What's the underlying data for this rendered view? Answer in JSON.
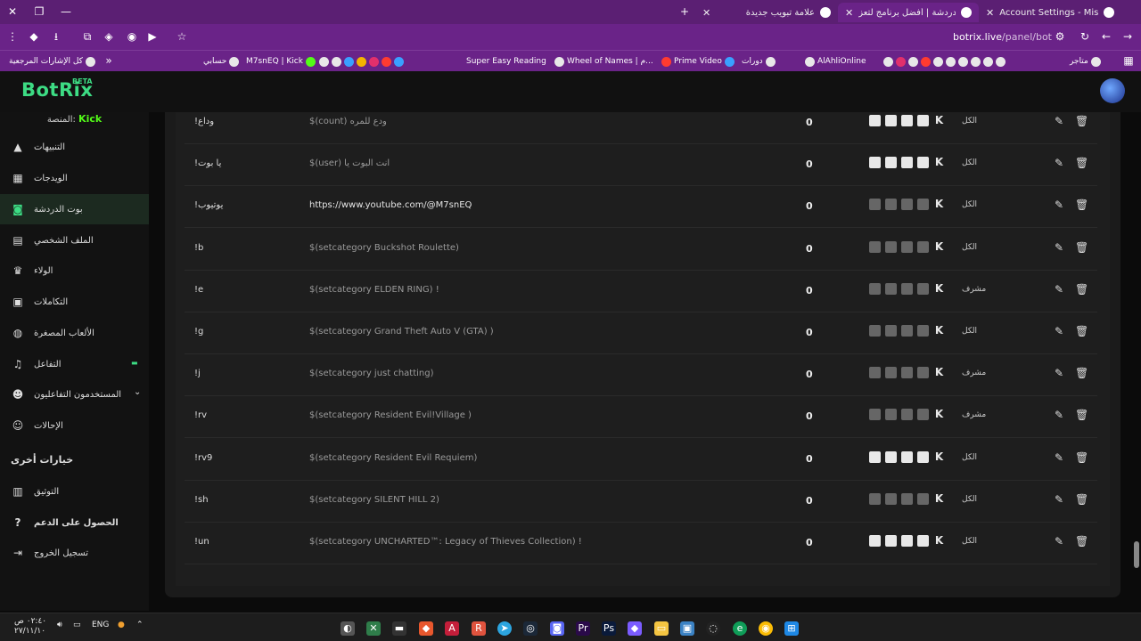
{
  "browser": {
    "tabs": [
      {
        "title": "Account Settings - MissXss AI B",
        "active": false
      },
      {
        "title": "بوت الدردشة | أفضل برنامج لتعز",
        "active": true
      },
      {
        "title": "علامة تبويب جديدة",
        "active": false
      }
    ],
    "url_host": "botrix.live",
    "url_path": "/panel/bot"
  },
  "bookmarks": [
    {
      "label": "كل الإشارات المرجعية",
      "icon": "folder-icon"
    },
    {
      "label": "حسابي",
      "icon": "globe-icon"
    },
    {
      "label": "M7snEQ | Kick",
      "icon": "kick-icon"
    },
    {
      "label": "Super Easy Reading",
      "icon": "globe-icon"
    },
    {
      "label": "Wheel of Names | م...",
      "icon": "globe-icon"
    },
    {
      "label": "Prime Video",
      "icon": "prime-icon"
    },
    {
      "label": "دورات",
      "icon": "folder-icon"
    },
    {
      "label": "AlAhliOnline",
      "icon": "globe-icon"
    },
    {
      "label": "متاجر",
      "icon": "folder-icon"
    }
  ],
  "app": {
    "logo": "BotRix",
    "logo_badge": "BETA",
    "platform_label": "المنصة:",
    "platform_value": "Kick"
  },
  "sidebar": {
    "items": [
      {
        "label": "التنبيهات",
        "icon": "alert-icon",
        "active": false
      },
      {
        "label": "الويدجات",
        "icon": "widgets-icon",
        "active": false
      },
      {
        "label": "بوت الدردشة",
        "icon": "robot-icon",
        "active": true
      },
      {
        "label": "الملف الشخصي",
        "icon": "profile-icon",
        "active": false
      },
      {
        "label": "الولاء",
        "icon": "trophy-icon",
        "active": false
      },
      {
        "label": "التكاملات",
        "icon": "integrations-icon",
        "active": false
      },
      {
        "label": "الألعاب المصغرة",
        "icon": "gamepad-icon",
        "active": false
      },
      {
        "label": "التفاعل",
        "icon": "music-icon",
        "active": false
      },
      {
        "label": "المستخدمون التفاعليون",
        "icon": "users-icon",
        "active": false
      },
      {
        "label": "الإحالات",
        "icon": "referrals-icon",
        "active": false
      }
    ],
    "other_title": "خيارات أخرى",
    "other_items": [
      {
        "label": "التوثيق",
        "icon": "docs-icon"
      },
      {
        "label": "الحصول على الدعم",
        "icon": "help-icon"
      },
      {
        "label": "تسجيل الخروج",
        "icon": "logout-icon"
      }
    ]
  },
  "commands": [
    {
      "command": "!وداع",
      "response": "$(count) ودع للمره",
      "count": "0",
      "platforms_active": true,
      "permission": "الكل",
      "white": false
    },
    {
      "command": "!يا بوت",
      "response": "$(user) انت البوت يا",
      "count": "0",
      "platforms_active": true,
      "permission": "الكل",
      "white": false
    },
    {
      "command": "!يوتيوب",
      "response": "https://www.youtube.com/@M7snEQ",
      "count": "0",
      "platforms_active": false,
      "permission": "الكل",
      "white": true
    },
    {
      "command": "!b",
      "response": "$(setcategory Buckshot Roulette)",
      "count": "0",
      "platforms_active": false,
      "permission": "الكل",
      "white": false
    },
    {
      "command": "!e",
      "response": "$(setcategory ELDEN RING) !",
      "count": "0",
      "platforms_active": false,
      "permission": "مشرف",
      "white": false
    },
    {
      "command": "!g",
      "response": "$(setcategory Grand Theft Auto V (GTA) )",
      "count": "0",
      "platforms_active": false,
      "permission": "الكل",
      "white": false
    },
    {
      "command": "!j",
      "response": "$(setcategory just chatting)",
      "count": "0",
      "platforms_active": false,
      "permission": "مشرف",
      "white": false
    },
    {
      "command": "!rv",
      "response": "$(setcategory Resident Evil!Village )",
      "count": "0",
      "platforms_active": false,
      "permission": "مشرف",
      "white": false
    },
    {
      "command": "!rv9",
      "response": "$(setcategory Resident Evil Requiem)",
      "count": "0",
      "platforms_active": true,
      "permission": "الكل",
      "white": false
    },
    {
      "command": "!sh",
      "response": "$(setcategory SILENT HILL 2)",
      "count": "0",
      "platforms_active": false,
      "permission": "الكل",
      "white": false
    },
    {
      "command": "!un",
      "response": "$(setcategory UNCHARTED™: Legacy of Thieves Collection) !",
      "count": "0",
      "platforms_active": true,
      "permission": "الكل",
      "white": false
    }
  ],
  "taskbar": {
    "time": "٠٢:٤٠ ص",
    "date": "٢٧/١١/١٠",
    "lang": "ENG"
  },
  "colors": {
    "brand": "#3ddc84",
    "kick": "#53fc18",
    "browser_frame": "#6a2388"
  }
}
